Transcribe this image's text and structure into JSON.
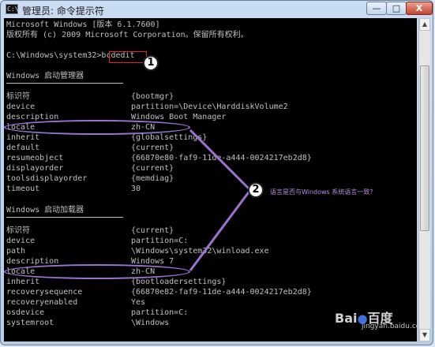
{
  "window": {
    "icon_text": "C:\\",
    "title": "管理员: 命令提示符",
    "minimize": "—",
    "maximize": "□",
    "close": "X"
  },
  "console": {
    "header_lines": [
      "Microsoft Windows [版本 6.1.7600]",
      "版权所有 (c) 2009 Microsoft Corporation。保留所有权利。"
    ],
    "prompt": "C:\\Windows\\system32>",
    "command": "bcdedit",
    "section1_title": "Windows 启动管理器",
    "section1_rows": [
      {
        "key": "标识符",
        "value": "{bootmgr}"
      },
      {
        "key": "device",
        "value": "partition=\\Device\\HarddiskVolume2"
      },
      {
        "key": "description",
        "value": "Windows Boot Manager"
      },
      {
        "key": "locale",
        "value": "zh-CN"
      },
      {
        "key": "inherit",
        "value": "{globalsettings}"
      },
      {
        "key": "default",
        "value": "{current}"
      },
      {
        "key": "resumeobject",
        "value": "{66870e80-faf9-11de-a444-0024217eb2d8}"
      },
      {
        "key": "displayorder",
        "value": "{current}"
      },
      {
        "key": "toolsdisplayorder",
        "value": "{memdiag}"
      },
      {
        "key": "timeout",
        "value": "30"
      }
    ],
    "section2_title": "Windows 启动加载器",
    "section2_rows": [
      {
        "key": "标识符",
        "value": "{current}"
      },
      {
        "key": "device",
        "value": "partition=C:"
      },
      {
        "key": "path",
        "value": "\\Windows\\system32\\winload.exe"
      },
      {
        "key": "description",
        "value": "Windows 7"
      },
      {
        "key": "locale",
        "value": "zh-CN"
      },
      {
        "key": "inherit",
        "value": "{bootloadersettings}"
      },
      {
        "key": "recoverysequence",
        "value": "{66870e82-faf9-11de-a444-0024217eb2d8}"
      },
      {
        "key": "recoveryenabled",
        "value": "Yes"
      },
      {
        "key": "osdevice",
        "value": "partition=C:"
      },
      {
        "key": "systemroot",
        "value": "\\Windows"
      }
    ]
  },
  "annotations": {
    "badge1": "1",
    "badge2": "2",
    "note": "语言是否与Windows 系统语言一致？",
    "accent_color": "#9b72cf",
    "box_color": "#e0262a"
  },
  "watermark": {
    "brand": "Bai",
    "brand2": "百度",
    "sub": "jingyan.baidu.com"
  },
  "scrollbar": {
    "up": "▲",
    "down": "▼"
  }
}
